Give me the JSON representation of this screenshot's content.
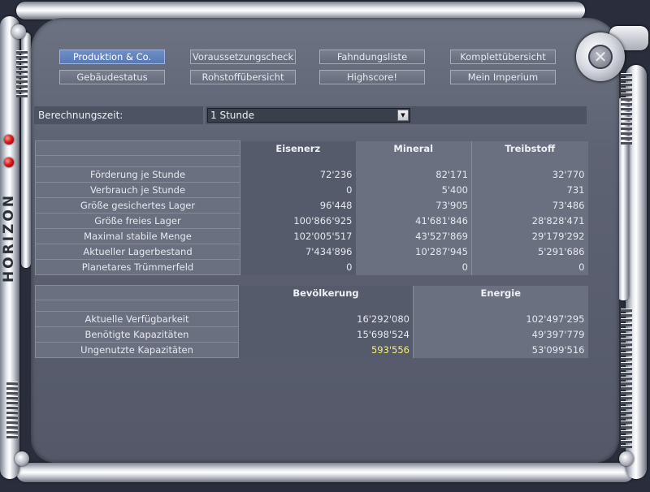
{
  "branding": {
    "logo_text": "HORIZON"
  },
  "nav": {
    "row1": [
      {
        "label": "Produktion & Co.",
        "active": true
      },
      {
        "label": "Voraussetzungscheck",
        "active": false
      },
      {
        "label": "Fahndungsliste",
        "active": false
      },
      {
        "label": "Komplettübersicht",
        "active": false
      }
    ],
    "row2": [
      {
        "label": "Gebäudestatus",
        "active": false
      },
      {
        "label": "Rohstoffübersicht",
        "active": false
      },
      {
        "label": "Highscore!",
        "active": false
      },
      {
        "label": "Mein Imperium",
        "active": false
      }
    ]
  },
  "calc": {
    "label": "Berechnungszeit:",
    "selected": "1 Stunde"
  },
  "resources": {
    "headers": [
      "",
      "Eisenerz",
      "Mineral",
      "Treibstoff"
    ],
    "rows": [
      {
        "label": "Förderung je Stunde",
        "values": [
          "72'236",
          "82'171",
          "32'770"
        ]
      },
      {
        "label": "Verbrauch je Stunde",
        "values": [
          "0",
          "5'400",
          "731"
        ]
      },
      {
        "label": "Größe gesichertes Lager",
        "values": [
          "96'448",
          "73'905",
          "73'486"
        ]
      },
      {
        "label": "Größe freies Lager",
        "values": [
          "100'866'925",
          "41'681'846",
          "28'828'471"
        ]
      },
      {
        "label": "Maximal stabile Menge",
        "values": [
          "102'005'517",
          "43'527'869",
          "29'179'292"
        ]
      },
      {
        "label": "Aktueller Lagerbestand",
        "values": [
          "7'434'896",
          "10'287'945",
          "5'291'686"
        ]
      },
      {
        "label": "Planetares Trümmerfeld",
        "values": [
          "0",
          "0",
          "0"
        ]
      }
    ]
  },
  "capacity": {
    "headers": [
      "",
      "Bevölkerung",
      "Energie"
    ],
    "rows": [
      {
        "label": "Aktuelle Verfügbarkeit",
        "values": [
          "16'292'080",
          "102'497'295"
        ]
      },
      {
        "label": "Benötigte Kapazitäten",
        "values": [
          "15'698'524",
          "49'397'779"
        ]
      },
      {
        "label": "Ungenutzte Kapazitäten",
        "values": [
          "593'556",
          "53'099'516"
        ],
        "highlight_first": true
      }
    ]
  },
  "colors": {
    "accent": "#5b7dbb",
    "highlight": "#f4f070",
    "panel": "#5e6373"
  }
}
